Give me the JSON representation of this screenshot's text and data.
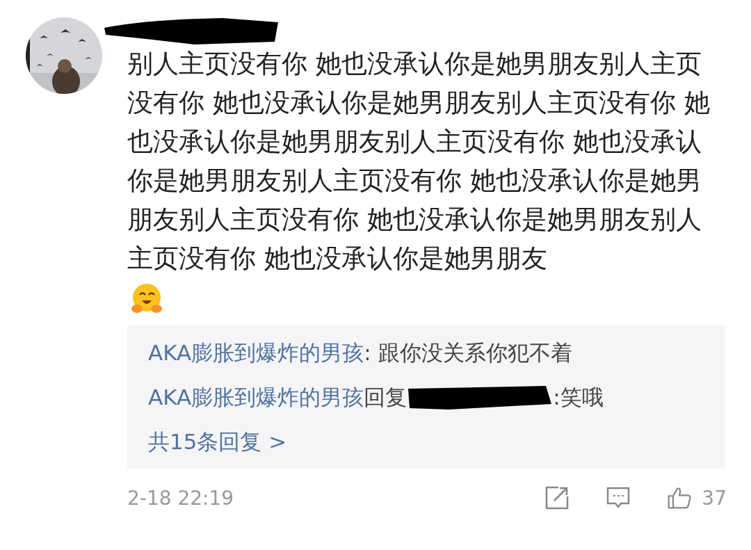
{
  "comment": {
    "text": "别人主页没有你 她也没承认你是她男朋友别人主页没有你 她也没承认你是她男朋友别人主页没有你 她也没承认你是她男朋友别人主页没有你 她也没承认你是她男朋友别人主页没有你 她也没承认你是她男朋友别人主页没有你 她也没承认你是她男朋友别人主页没有你 她也没承认你是她男朋友",
    "replies": [
      {
        "author": "AKA膨胀到爆炸的男孩",
        "text": ": 跟你没关系你犯不着",
        "redacted_target": false
      },
      {
        "author": "AKA膨胀到爆炸的男孩",
        "reply_word": "回复",
        "text": ":笑哦",
        "redacted_target": true
      }
    ],
    "more_replies": "共15条回复 >",
    "time": "2-18 22:19",
    "likes": "37"
  }
}
